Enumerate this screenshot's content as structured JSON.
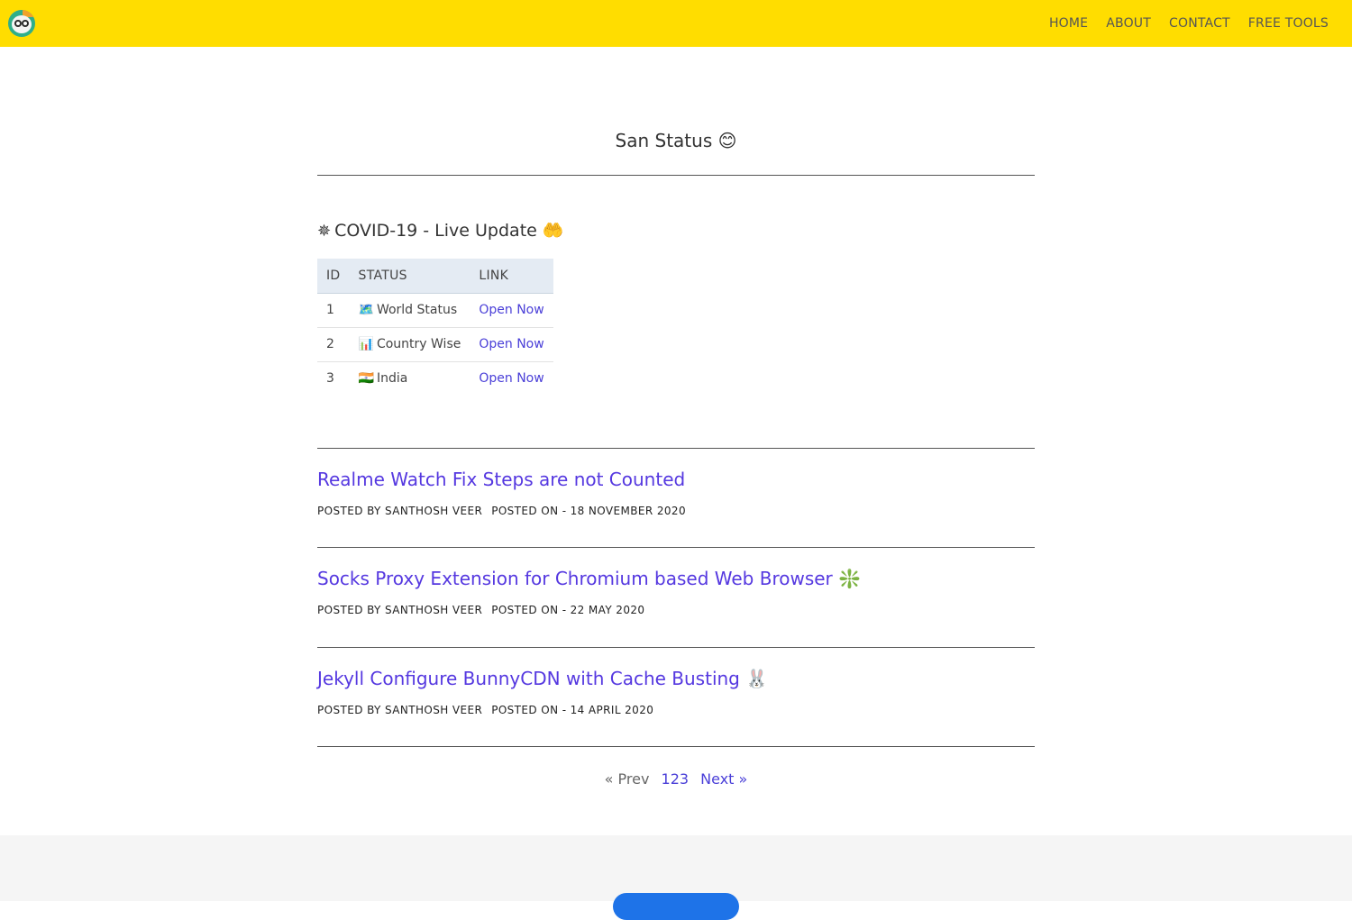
{
  "header": {
    "logo_alt": "",
    "nav": [
      {
        "label": "HOME"
      },
      {
        "label": "ABOUT"
      },
      {
        "label": "CONTACT"
      },
      {
        "label": "FREE TOOLS"
      }
    ]
  },
  "site_title": "San Status 😊",
  "covid": {
    "heading": "COVID-19 - Live Update",
    "icon_left": "gear-icon",
    "icon_right": "hand-drop-icon",
    "columns": [
      "ID",
      "STATUS",
      "LINK"
    ],
    "rows": [
      {
        "id": "1",
        "emoji": "🗺️",
        "status": "World Status",
        "link": "Open Now"
      },
      {
        "id": "2",
        "emoji": "📊",
        "status": "Country Wise",
        "link": "Open Now"
      },
      {
        "id": "3",
        "emoji": "🇮🇳",
        "status": "India",
        "link": "Open Now"
      }
    ]
  },
  "posts": [
    {
      "title": "Realme Watch Fix Steps are not Counted",
      "author": "POSTED BY SANTHOSH VEER",
      "date": "POSTED ON - 18 NOVEMBER 2020"
    },
    {
      "title": "Socks Proxy Extension for Chromium based Web Browser ❇️",
      "author": "POSTED BY SANTHOSH VEER",
      "date": "POSTED ON - 22 MAY 2020"
    },
    {
      "title": "Jekyll Configure BunnyCDN with Cache Busting 🐰",
      "author": "POSTED BY SANTHOSH VEER",
      "date": "POSTED ON - 14 APRIL 2020"
    }
  ],
  "pagination": {
    "prev": "« Prev",
    "pages": "123",
    "next": "Next »"
  },
  "colors": {
    "header_bg": "#ffdd00",
    "link": "#5538e0",
    "table_header_bg": "#e4ebf3"
  }
}
